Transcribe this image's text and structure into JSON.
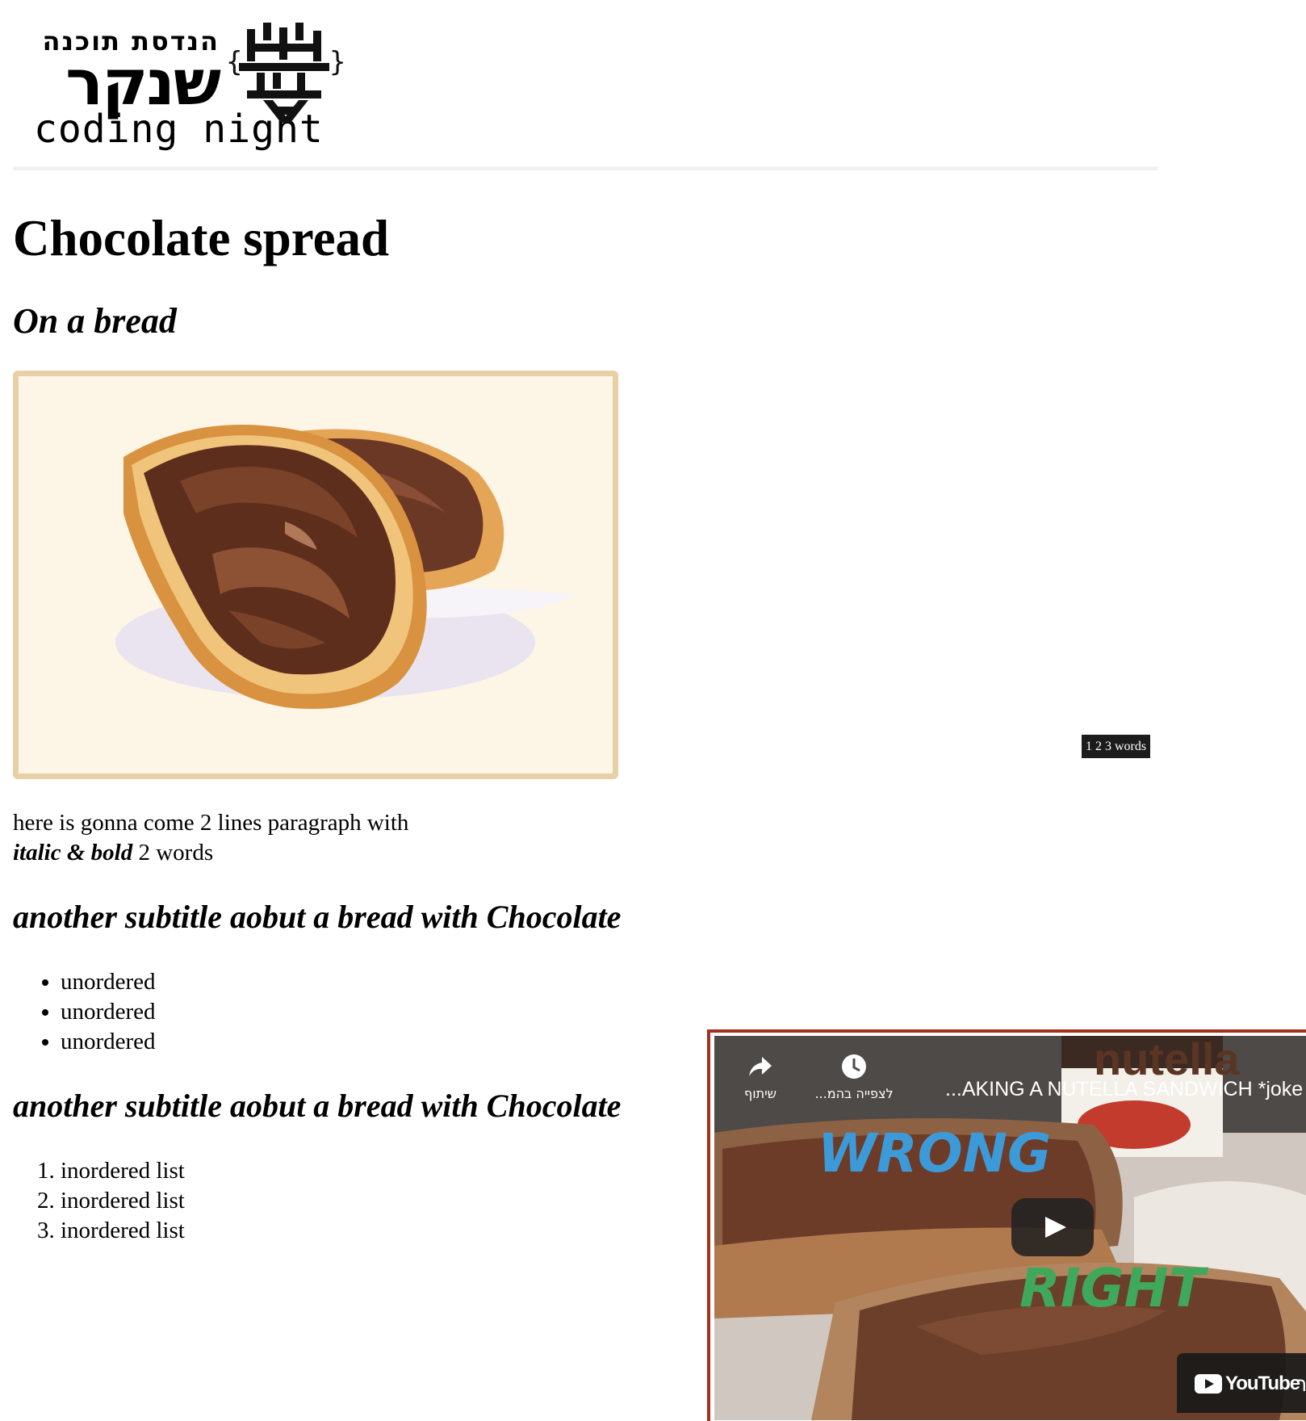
{
  "logo": {
    "hebrew_small": "הנדסת תוכנה",
    "hebrew_big": "שנקר",
    "english": "coding night"
  },
  "heading": "Chocolate spread",
  "subheading": "On a bread",
  "image": {
    "alt": "Bread slices with chocolate spread",
    "border_color": "#e8cfa6"
  },
  "word_counter": "1 2 3 words",
  "paragraph": {
    "line1": "here is gonna come 2 lines paragraph with",
    "italic": "italic",
    "amp": "&",
    "bold": "bold",
    "rest": "2 words"
  },
  "subtitle1": "another subtitle aobut a bread with Chocolate",
  "unordered_list": [
    "unordered",
    "unordered",
    "unordered"
  ],
  "subtitle2": "another subtitle aobut a bread with Chocolate",
  "ordered_list": [
    "inordered list",
    "inordered list",
    "inordered list"
  ],
  "video": {
    "title": "...AKING A NUTELLA SANDWICH *joke",
    "share_label": "שיתוף",
    "watch_later_label": "...לצפייה בהמ",
    "overlay_wrong": "WRONG",
    "overlay_right": "RIGHT",
    "jar_text": "nutella",
    "brand": "YouTube",
    "brand_suffix": "דר",
    "border_color": "#a5301c"
  }
}
